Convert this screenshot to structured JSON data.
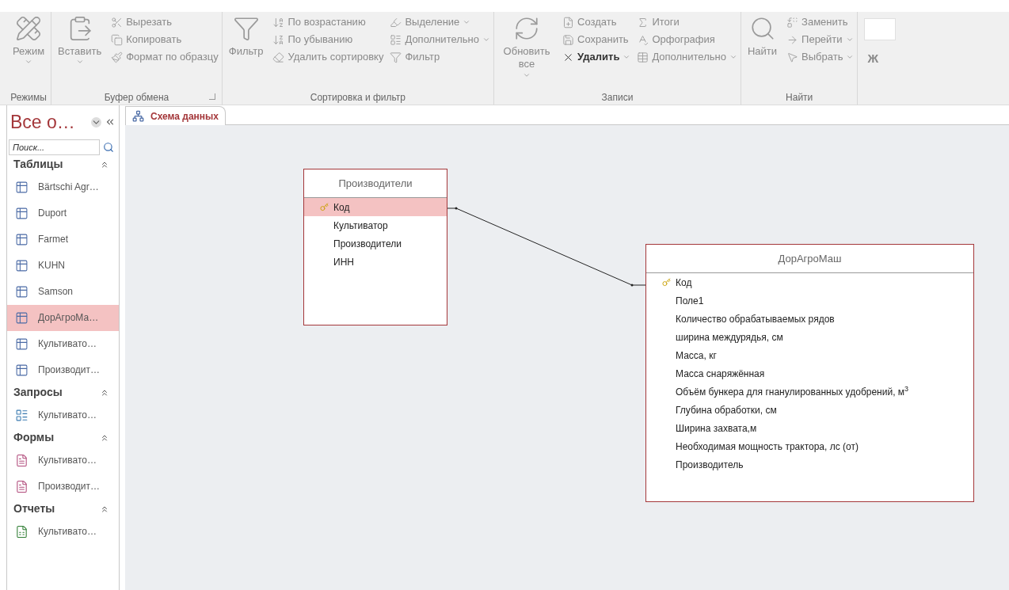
{
  "ribbon": {
    "groups": [
      {
        "label": "Режимы",
        "launcher": false,
        "items": [
          {
            "kind": "large",
            "label": "Режим",
            "dropdown": true,
            "disabled": true
          }
        ]
      },
      {
        "label": "Буфер обмена",
        "launcher": true,
        "items": [
          {
            "kind": "large",
            "label": "Вставить",
            "dropdown": true,
            "disabled": true
          },
          {
            "kind": "small",
            "label": "Вырезать",
            "dropdown": false,
            "disabled": true
          },
          {
            "kind": "small",
            "label": "Копировать",
            "dropdown": false,
            "disabled": true
          },
          {
            "kind": "small",
            "label": "Формат по образцу",
            "dropdown": false,
            "disabled": true
          }
        ]
      },
      {
        "label": "Сортировка и фильтр",
        "launcher": false,
        "items": [
          {
            "kind": "large",
            "label": "Фильтр",
            "dropdown": false,
            "disabled": true
          },
          {
            "kind": "small",
            "label": "По возрастанию",
            "dropdown": false,
            "disabled": true
          },
          {
            "kind": "small",
            "label": "По убыванию",
            "dropdown": false,
            "disabled": true
          },
          {
            "kind": "small",
            "label": "Удалить сортировку",
            "dropdown": false,
            "disabled": true
          },
          {
            "kind": "small",
            "label": "Выделение",
            "dropdown": true,
            "disabled": true
          },
          {
            "kind": "small",
            "label": "Дополнительно",
            "dropdown": true,
            "disabled": true
          },
          {
            "kind": "small",
            "label": "Фильтр",
            "dropdown": false,
            "disabled": true
          }
        ]
      },
      {
        "label": "Записи",
        "launcher": false,
        "items": [
          {
            "kind": "large",
            "label": "Обновить все",
            "dropdown": true,
            "disabled": true
          },
          {
            "kind": "small",
            "label": "Создать",
            "dropdown": false,
            "disabled": true
          },
          {
            "kind": "small",
            "label": "Сохранить",
            "dropdown": false,
            "disabled": true
          },
          {
            "kind": "small",
            "label": "Удалить",
            "dropdown": true,
            "disabled": false
          },
          {
            "kind": "small",
            "label": "Итоги",
            "dropdown": false,
            "disabled": true
          },
          {
            "kind": "small",
            "label": "Орфография",
            "dropdown": false,
            "disabled": true
          },
          {
            "kind": "small",
            "label": "Дополнительно",
            "dropdown": true,
            "disabled": true
          }
        ]
      },
      {
        "label": "Найти",
        "launcher": false,
        "items": [
          {
            "kind": "large",
            "label": "Найти",
            "dropdown": false,
            "disabled": true
          },
          {
            "kind": "small",
            "label": "Заменить",
            "dropdown": false,
            "disabled": true
          },
          {
            "kind": "small",
            "label": "Перейти",
            "dropdown": true,
            "disabled": true
          },
          {
            "kind": "small",
            "label": "Выбрать",
            "dropdown": true,
            "disabled": true
          }
        ]
      }
    ],
    "bold_button": "Ж"
  },
  "nav_pane": {
    "title": "Все о…",
    "search": {
      "placeholder": "Поиск..."
    },
    "sections": [
      {
        "title": "Таблицы",
        "expanded": true,
        "items": [
          {
            "kind": "table",
            "label": "Bärtschi Agr…",
            "selected": false
          },
          {
            "kind": "table",
            "label": "Duport",
            "selected": false
          },
          {
            "kind": "table",
            "label": "Farmet",
            "selected": false
          },
          {
            "kind": "table",
            "label": "KUHN",
            "selected": false
          },
          {
            "kind": "table",
            "label": "Samson",
            "selected": false
          },
          {
            "kind": "table",
            "label": "ДорАгроМа…",
            "selected": true
          },
          {
            "kind": "table",
            "label": "Культивато…",
            "selected": false
          },
          {
            "kind": "table",
            "label": "Производит…",
            "selected": false
          }
        ]
      },
      {
        "title": "Запросы",
        "expanded": true,
        "items": [
          {
            "kind": "query",
            "label": "Культивато…",
            "selected": false
          }
        ]
      },
      {
        "title": "Формы",
        "expanded": true,
        "items": [
          {
            "kind": "form",
            "label": "Культивато…",
            "selected": false
          },
          {
            "kind": "form",
            "label": "Производит…",
            "selected": false
          }
        ]
      },
      {
        "title": "Отчеты",
        "expanded": true,
        "items": [
          {
            "kind": "report",
            "label": "Культивато…",
            "selected": false
          }
        ]
      }
    ]
  },
  "document_tab": {
    "label": "Схема данных",
    "selected": true
  },
  "relationships": {
    "tables": [
      {
        "name": "Производители",
        "fields": [
          {
            "name": "Код",
            "primary_key": true,
            "selected": true
          },
          {
            "name": "Культиватор",
            "primary_key": false,
            "selected": false
          },
          {
            "name": "Производители",
            "primary_key": false,
            "selected": false
          },
          {
            "name": "ИНН",
            "primary_key": false,
            "selected": false
          }
        ]
      },
      {
        "name": "ДорАгроМаш",
        "fields": [
          {
            "name": "Код",
            "primary_key": true,
            "selected": false
          },
          {
            "name": "Поле1",
            "primary_key": false,
            "selected": false
          },
          {
            "name": "Количество обрабатываемых рядов",
            "primary_key": false,
            "selected": false
          },
          {
            "name": "ширина междурядья, см",
            "primary_key": false,
            "selected": false
          },
          {
            "name": "Масса, кг",
            "primary_key": false,
            "selected": false
          },
          {
            "name": "Масса снаряжённая",
            "primary_key": false,
            "selected": false
          },
          {
            "name": "Объём бункера для гнанулированных удобрений, м$^{3}$",
            "primary_key": false,
            "selected": false
          },
          {
            "name": "Глубина обработки, см",
            "primary_key": false,
            "selected": false
          },
          {
            "name": "Ширина захвата,м",
            "primary_key": false,
            "selected": false
          },
          {
            "name": "Необходимая мощность трактора, лс (от)",
            "primary_key": false,
            "selected": false
          },
          {
            "name": "Производитель",
            "primary_key": false,
            "selected": false
          }
        ]
      }
    ]
  }
}
